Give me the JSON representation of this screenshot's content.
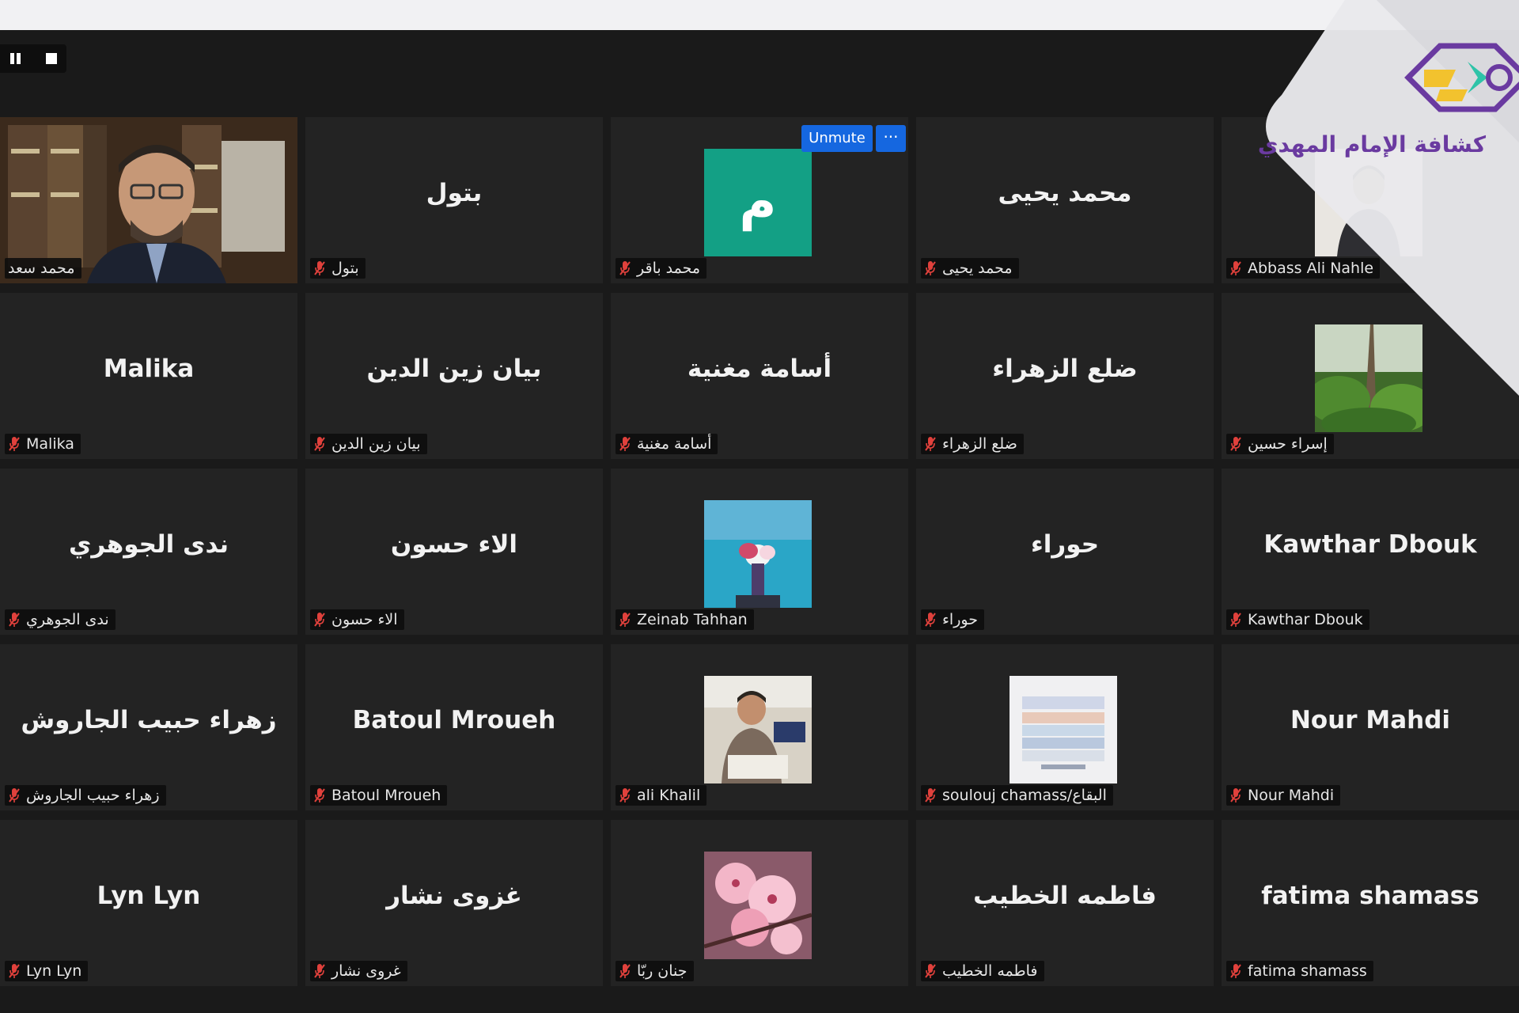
{
  "controls": {
    "pause_icon": "pause-icon",
    "stop_icon": "stop-icon"
  },
  "hover": {
    "unmute_label": "Unmute",
    "more_label": "···"
  },
  "logo": {
    "text": "كشافة الإمام المهدي",
    "colors": [
      "#f2c22e",
      "#2ec3a8",
      "#6a3aa0"
    ]
  },
  "tiles": [
    {
      "label": "محمد سعد"
    },
    {
      "name": "بتول",
      "label": "بتول"
    },
    {
      "avatar_initial": "م",
      "avatar_color": "#13a085",
      "label": "محمد باقر"
    },
    {
      "name": "محمد يحيى",
      "label": "محمد يحيى"
    },
    {
      "label": "Abbass Ali Nahle"
    },
    {
      "name": "Malika",
      "label": "Malika"
    },
    {
      "name": "بيان زين الدين",
      "label": "بيان زين الدين"
    },
    {
      "name": "أسامة مغنية",
      "label": "أسامة مغنية"
    },
    {
      "name": "ضلع الزهراء",
      "label": "ضلع الزهراء"
    },
    {
      "label": "إسراء حسين"
    },
    {
      "name": "ندى الجوهري",
      "label": "ندى الجوهري"
    },
    {
      "name": "الاء حسون",
      "label": "الاء حسون"
    },
    {
      "label": "Zeinab Tahhan"
    },
    {
      "name": "حوراء",
      "label": "حوراء"
    },
    {
      "name": "Kawthar Dbouk",
      "label": "Kawthar Dbouk"
    },
    {
      "name": "زهراء حبيب الجاروش",
      "label": "زهراء حبيب الجاروش"
    },
    {
      "name": "Batoul Mroueh",
      "label": "Batoul Mroueh"
    },
    {
      "label": "ali Khalil"
    },
    {
      "label": "soulouj chamass/البقاع"
    },
    {
      "name": "Nour Mahdi",
      "label": "Nour Mahdi"
    },
    {
      "name": "Lyn Lyn",
      "label": "Lyn Lyn"
    },
    {
      "name": "غزوى نشار",
      "label": "غروى نشار"
    },
    {
      "label": "جنان ربّا"
    },
    {
      "name": "فاطمه  الخطيب",
      "label": "فاطمه  الخطيب"
    },
    {
      "name": "fatima shamass",
      "label": "fatima shamass"
    }
  ]
}
